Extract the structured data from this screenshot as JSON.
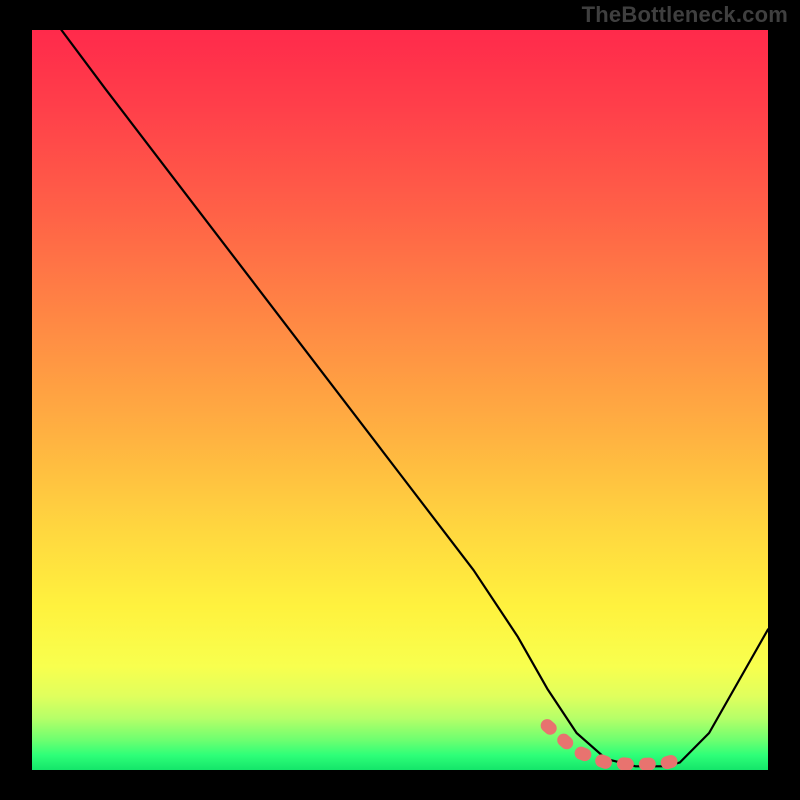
{
  "watermark": "TheBottleneck.com",
  "chart_data": {
    "type": "line",
    "title": "",
    "xlabel": "",
    "ylabel": "",
    "xlim": [
      0,
      100
    ],
    "ylim": [
      0,
      100
    ],
    "series": [
      {
        "name": "bottleneck-curve",
        "x": [
          4,
          10,
          20,
          30,
          40,
          50,
          60,
          66,
          70,
          74,
          78,
          82,
          86,
          88,
          92,
          100
        ],
        "y": [
          100,
          92,
          79,
          66,
          53,
          40,
          27,
          18,
          11,
          5,
          1.5,
          0.5,
          0.5,
          1,
          5,
          19
        ]
      }
    ],
    "highlight_range": {
      "name": "optimal-zone",
      "x": [
        70,
        74,
        78,
        82,
        86,
        88
      ],
      "y": [
        6,
        2.5,
        1,
        0.7,
        0.9,
        1.5
      ]
    },
    "gradient_stops": [
      {
        "pos": 0,
        "color": "#ff2a4b"
      },
      {
        "pos": 25,
        "color": "#ff6247"
      },
      {
        "pos": 55,
        "color": "#ffb241"
      },
      {
        "pos": 78,
        "color": "#fff23e"
      },
      {
        "pos": 96,
        "color": "#6cff70"
      },
      {
        "pos": 100,
        "color": "#14e56a"
      }
    ]
  }
}
